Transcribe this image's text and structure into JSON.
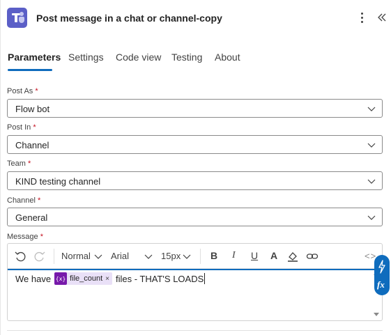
{
  "header": {
    "title": "Post message in a chat or channel-copy",
    "app_icon": "teams-icon",
    "more_icon": "more-vertical-icon",
    "collapse_icon": "double-chevron-left-icon"
  },
  "tabs": [
    {
      "label": "Parameters",
      "active": true
    },
    {
      "label": "Settings",
      "active": false
    },
    {
      "label": "Code view",
      "active": false
    },
    {
      "label": "Testing",
      "active": false
    },
    {
      "label": "About",
      "active": false
    }
  ],
  "fields": {
    "post_as": {
      "label": "Post As",
      "required_mark": "*",
      "value": "Flow bot"
    },
    "post_in": {
      "label": "Post In",
      "required_mark": "*",
      "value": "Channel"
    },
    "team": {
      "label": "Team",
      "required_mark": "*",
      "value": "KIND testing channel"
    },
    "channel": {
      "label": "Channel",
      "required_mark": "*",
      "value": "General"
    },
    "message": {
      "label": "Message",
      "required_mark": "*"
    }
  },
  "toolbar": {
    "paragraph_style": "Normal",
    "font_family": "Arial",
    "font_size": "15px",
    "bold": "B",
    "italic": "I",
    "underline": "U",
    "font_color": "A",
    "code_view": "<>"
  },
  "message": {
    "text_before": "We have",
    "token_icon": "{x}",
    "token_label": "file_count",
    "token_close": "×",
    "text_after": "files - THAT'S LOADS"
  },
  "side_actions": {
    "dynamic_content_icon": "lightning-icon",
    "expression_icon": "fx-icon"
  },
  "colors": {
    "accent": "#0f6cbd",
    "teams_brand": "#5b5fc7",
    "token_bg": "#e9e0f7",
    "token_icon_bg": "#7719aa",
    "required": "#c50f1f"
  }
}
